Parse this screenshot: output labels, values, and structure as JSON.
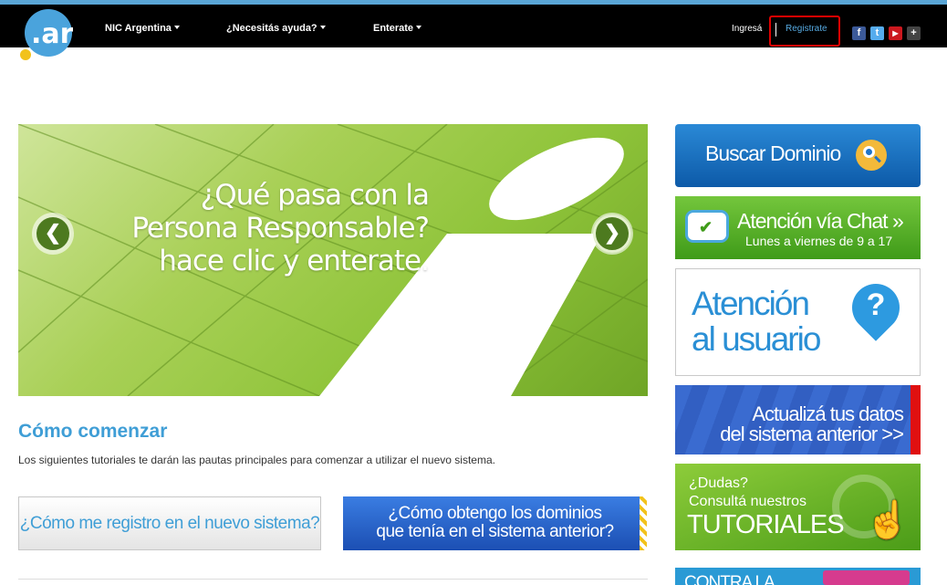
{
  "logo": {
    "text": ".ar"
  },
  "nav": {
    "items": [
      {
        "label": "NIC Argentina"
      },
      {
        "label": "¿Necesitás ayuda?"
      },
      {
        "label": "Enterate"
      }
    ],
    "login_label": "Ingresá",
    "register_label": "Registrate",
    "social": [
      {
        "icon": "facebook-icon",
        "glyph": "f",
        "color": "#3b5998"
      },
      {
        "icon": "twitter-icon",
        "glyph": "t",
        "color": "#55acee"
      },
      {
        "icon": "youtube-icon",
        "glyph": "▶",
        "color": "#cc181e"
      },
      {
        "icon": "google-plus-icon",
        "glyph": "+",
        "color": "#444444"
      }
    ]
  },
  "hero": {
    "lines": [
      "¿Qué pasa con la",
      "Persona Responsable?",
      "hace clic y enterate."
    ],
    "prev_glyph": "❮",
    "next_glyph": "❯"
  },
  "start": {
    "title": "Cómo comenzar",
    "description": "Los siguientes tutoriales te darán las pautas principales para comenzar a utilizar el nuevo sistema.",
    "button1": "¿Cómo me registro en el nuevo sistema?",
    "button2_line1": "¿Cómo obtengo los dominios",
    "button2_line2": "que tenía en el  sistema anterior?"
  },
  "sidebar": {
    "domain": "Buscar Dominio",
    "chat_title": "Atención vía Chat »",
    "chat_sub": "Lunes a viernes de 9 a 17",
    "user_line1": "Atención",
    "user_line2": "al usuario",
    "user_icon": "?",
    "update_line1": "Actualizá tus datos",
    "update_line2": "del sistema anterior >>",
    "tuto_line1": "¿Dudas?",
    "tuto_line2": "Consultá nuestros",
    "tuto_big": "TUTORIALES",
    "contra_text": "CONTRA LA"
  }
}
